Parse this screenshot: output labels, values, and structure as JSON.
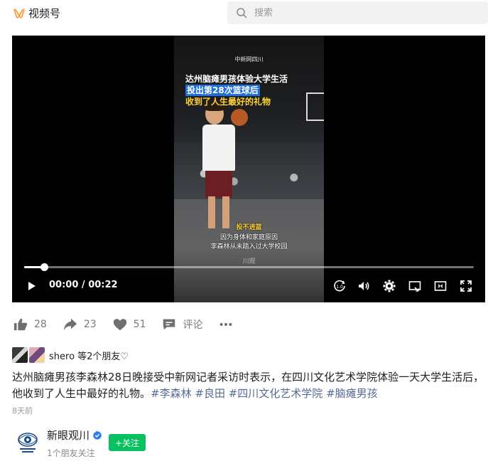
{
  "header": {
    "app_name": "视频号",
    "search_placeholder": "搜索"
  },
  "video": {
    "overlay": {
      "brand": "中新网四川",
      "caption_line1": "达州脑瘫男孩体验大学生活",
      "caption_line2": "投出第28次篮球后",
      "caption_line3": "收到了人生最好的礼物",
      "subtitle_tag": "投不进篮",
      "subtitle_line1": "因为身体和家庭原因",
      "subtitle_line2": "李森林从未踏入过大学校园",
      "watermark": "川观"
    },
    "progress_fraction": 0.045,
    "current_time": "00:00",
    "separator": " / ",
    "duration": "00:22"
  },
  "actions": {
    "likes": "28",
    "shares": "23",
    "hearts": "51",
    "comment_label": "评论"
  },
  "friends": {
    "text": "shero 等2个朋友♡"
  },
  "description": {
    "text": "达州脑瘫男孩李森林28日晚接受中新网记者采访时表示，在四川文化艺术学院体验一天大学生活后，他收到了人生中最好的礼物。",
    "tags": [
      "#李森林",
      "#良田",
      "#四川文化艺术学院",
      "#脑瘫男孩"
    ],
    "time_ago": "8天前"
  },
  "author": {
    "name": "新眼观川",
    "follow_label": "+关注",
    "friend_follow_text": "1个朋友关注"
  },
  "colors": {
    "accent_green": "#07c160",
    "tag_blue": "#576b95",
    "logo_orange": "#fa9d3b"
  }
}
